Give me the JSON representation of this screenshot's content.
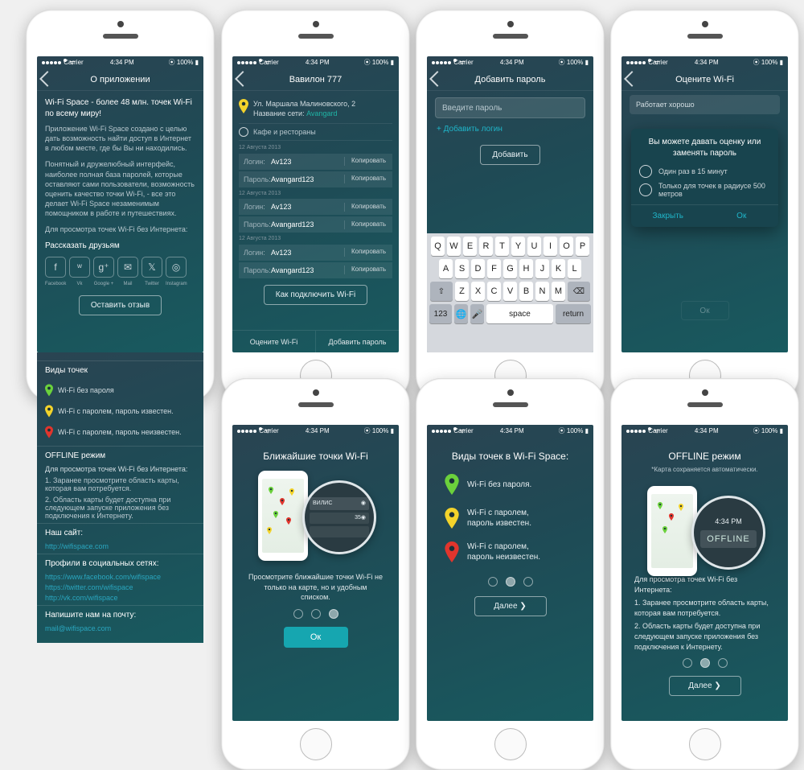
{
  "status": {
    "carrier": "Carrier",
    "time": "4:34 PM",
    "battery": "100%"
  },
  "p1": {
    "title": "О приложении",
    "headline": "Wi-Fi Space - более 48 млн. точек Wi-Fi по всему миру!",
    "para1": "Приложение Wi-Fi Space создано с целью дать возможность найти доступ в Интернет в любом месте, где бы Вы ни находились.",
    "para2": "Понятный и дружелюбный интерфейс, наиболее полная база паролей, которые оставляют сами пользователи, возможность оценить качество точки Wi-Fi, - все это делает Wi-Fi Space незаменимым помощником в работе и путешествиях.",
    "para3": "Для просмотра точек Wi-Fi без Интернета:",
    "share_h": "Рассказать друзьям",
    "share": [
      "Facebook",
      "Vk",
      "Google +",
      "Mail",
      "Twitter",
      "Instagram"
    ],
    "review_btn": "Оставить отзыв",
    "types_h": "Виды точек",
    "types": [
      "Wi-Fi без пароля",
      "Wi-Fi с паролем, пароль известен.",
      "Wi-Fi с паролем, пароль неизвестен."
    ],
    "offline_h": "OFFLINE режим",
    "offline_intro": "Для просмотра точек Wi-Fi без Интернета:",
    "offline_1": "1. Заранее просмотрите область карты, которая вам потребуется.",
    "offline_2": "2. Область карты будет доступна при следующем запуске приложения без подключения к Интернету.",
    "site_h": "Наш сайт:",
    "site": "http://wifispace.com",
    "soc_h": "Профили в социальных сетях:",
    "soc": [
      "https://www.facebook.com/wifispace",
      "https://twitter.com/wifispace",
      "http://vk.com/wifispace"
    ],
    "mail_h": "Напишите нам на почту:",
    "mail": "mail@wifispace.com"
  },
  "p2": {
    "title": "Вавилон  777",
    "addr": "Ул. Маршала Малиновского, 2",
    "net_lbl": "Название сети:",
    "net": "Avangard",
    "cat": "Кафе и рестораны",
    "date": "12 Августа 2013",
    "login_lbl": "Логин:",
    "pass_lbl": "Пароль:",
    "login": "Av123",
    "pass": "Avangard123",
    "copy": "Копировать",
    "howto": "Как подключить Wi-Fi",
    "bb_rate": "Оцените Wi-Fi",
    "bb_add": "Добавить пароль"
  },
  "p3": {
    "title": "Добавить пароль",
    "placeholder": "Введите пароль",
    "add_login": "+ Добавить логин",
    "add_btn": "Добавить",
    "krow1": [
      "Q",
      "W",
      "E",
      "R",
      "T",
      "Y",
      "U",
      "I",
      "O",
      "P"
    ],
    "krow2": [
      "A",
      "S",
      "D",
      "F",
      "G",
      "H",
      "J",
      "K",
      "L"
    ],
    "krow3": [
      "Z",
      "X",
      "C",
      "V",
      "B",
      "N",
      "M"
    ],
    "shift": "⇧",
    "del": "⌫",
    "num": "123",
    "globe": "🌐",
    "mic": "🎤",
    "space": "space",
    "ret": "return"
  },
  "p4": {
    "title": "Оцените Wi-Fi",
    "chip": "Работает хорошо",
    "mh": "Вы можете давать оценку или заменять пароль",
    "m1": "Один раз в 15 минут",
    "m2": "Только для точек в радиусе 500 метров",
    "close": "Закрыть",
    "ok": "Ок"
  },
  "p5": {
    "title": "Ближайшие точки Wi-Fi",
    "text": "Просмотрите ближайшие точки Wi-Fi не только на карте, но и удобным списком.",
    "ok": "Ок",
    "zbadge": "ВИЛИС",
    "zcount": "35"
  },
  "p6": {
    "title": "Виды точек в Wi-Fi Space:",
    "r1": "Wi-Fi без пароля.",
    "r2": "Wi-Fi с паролем,\nпароль известен.",
    "r3": "Wi-Fi с паролем,\nпароль неизвестен.",
    "next": "Далее"
  },
  "p7": {
    "title": "OFFLINE режим",
    "sub": "*Карта сохраняется автоматически.",
    "ztime": "4:34 PM",
    "zoff": "OFFLINE",
    "intro": "Для просмотра точек Wi-Fi без Интернета:",
    "s1": "1. Заранее просмотрите область карты, которая вам потребуется.",
    "s2": "2. Область карты будет доступна при следующем запуске приложения без подключения к Интернету.",
    "next": "Далее"
  },
  "pins": {
    "green": "#6bd13c",
    "yellow": "#f3d32b",
    "red": "#e1352d"
  }
}
